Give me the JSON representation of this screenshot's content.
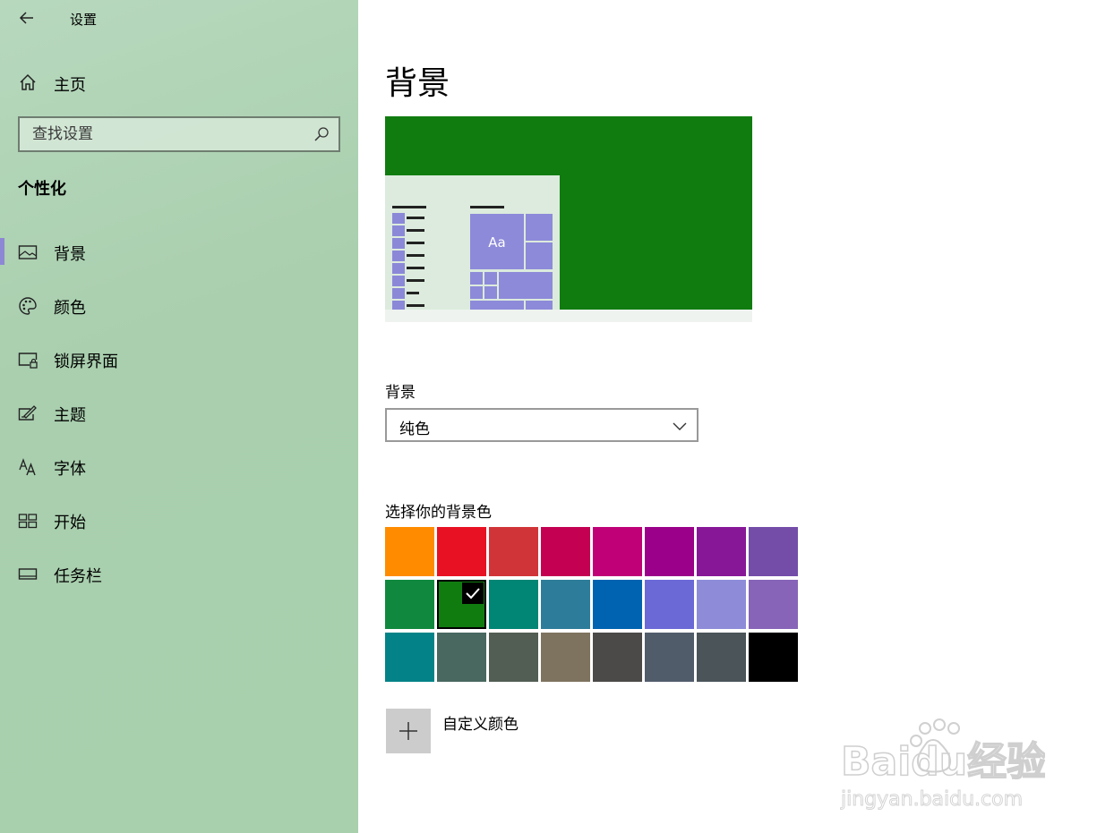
{
  "window": {
    "title": "设置"
  },
  "sidebar": {
    "home_label": "主页",
    "search_placeholder": "查找设置",
    "section_title": "个性化",
    "items": [
      {
        "label": "背景",
        "icon": "image-icon",
        "selected": true
      },
      {
        "label": "颜色",
        "icon": "palette-icon",
        "selected": false
      },
      {
        "label": "锁屏界面",
        "icon": "lock-screen-icon",
        "selected": false
      },
      {
        "label": "主题",
        "icon": "theme-icon",
        "selected": false
      },
      {
        "label": "字体",
        "icon": "font-icon",
        "selected": false
      },
      {
        "label": "开始",
        "icon": "start-icon",
        "selected": false
      },
      {
        "label": "任务栏",
        "icon": "taskbar-icon",
        "selected": false
      }
    ]
  },
  "main": {
    "title": "背景",
    "preview": {
      "sample_text": "Aa",
      "bg_color": "#107c10",
      "accent_color": "#8d8ad9"
    },
    "background_label": "背景",
    "background_value": "纯色",
    "colors_label": "选择你的背景色",
    "colors": [
      "#ff8c00",
      "#e81123",
      "#d13438",
      "#c30052",
      "#bf0077",
      "#9a0089",
      "#881798",
      "#744da9",
      "#10893e",
      "#107c10",
      "#018574",
      "#2d7d9a",
      "#0063b1",
      "#6b69d6",
      "#8e8cd8",
      "#8764b8",
      "#038387",
      "#486860",
      "#525e54",
      "#7e735f",
      "#4c4a48",
      "#515c6b",
      "#4a5459",
      "#000000"
    ],
    "selected_color_index": 9,
    "custom_color_label": "自定义颜色"
  },
  "watermark": {
    "text": "Baidu经验",
    "subtext": "jingyan.baidu.com"
  }
}
